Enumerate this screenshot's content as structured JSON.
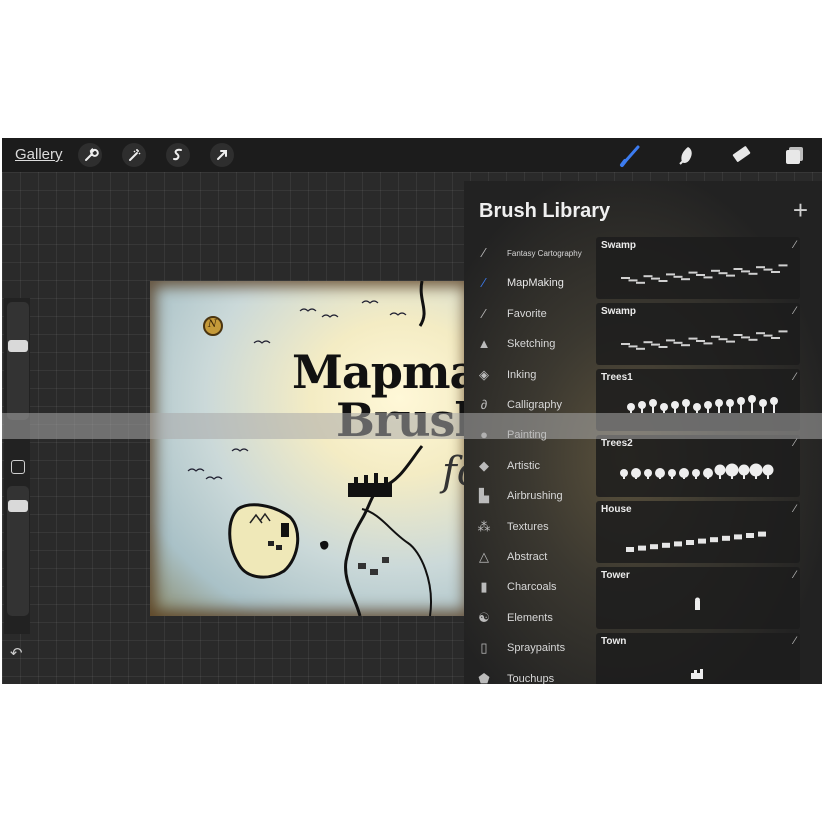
{
  "toolbar": {
    "gallery_label": "Gallery",
    "icons": [
      "wrench-icon",
      "magic-wand-icon",
      "selection-icon",
      "transform-arrow-icon",
      "brush-icon",
      "smudge-icon",
      "eraser-icon",
      "layers-icon"
    ],
    "active_color": "#3c7cf0"
  },
  "canvas": {
    "title_line1": "Mapma",
    "title_line2": "Brush",
    "title_line3": "fo",
    "compass_letter": "N"
  },
  "brush_library": {
    "title": "Brush Library",
    "add_label": "+",
    "sets": [
      {
        "label": "Fantasy Cartography",
        "icon": "stroke-icon"
      },
      {
        "label": "MapMaking",
        "icon": "stroke-icon"
      },
      {
        "label": "Favorite",
        "icon": "stroke-icon"
      },
      {
        "label": "Sketching",
        "icon": "pencil-icon"
      },
      {
        "label": "Inking",
        "icon": "ink-drop-icon"
      },
      {
        "label": "Calligraphy",
        "icon": "calligraphy-icon"
      },
      {
        "label": "Painting",
        "icon": "paint-drop-icon"
      },
      {
        "label": "Artistic",
        "icon": "artistic-drop-icon"
      },
      {
        "label": "Airbrushing",
        "icon": "airbrush-icon"
      },
      {
        "label": "Textures",
        "icon": "texture-icon"
      },
      {
        "label": "Abstract",
        "icon": "triangle-icon"
      },
      {
        "label": "Charcoals",
        "icon": "charcoal-icon"
      },
      {
        "label": "Elements",
        "icon": "yin-yang-icon"
      },
      {
        "label": "Spraypaints",
        "icon": "spray-can-icon"
      },
      {
        "label": "Touchups",
        "icon": "touchup-icon"
      }
    ],
    "brushes": [
      {
        "name": "Swamp"
      },
      {
        "name": "Swamp"
      },
      {
        "name": "Trees1"
      },
      {
        "name": "Trees2"
      },
      {
        "name": "House"
      },
      {
        "name": "Tower"
      },
      {
        "name": "Town"
      }
    ]
  }
}
